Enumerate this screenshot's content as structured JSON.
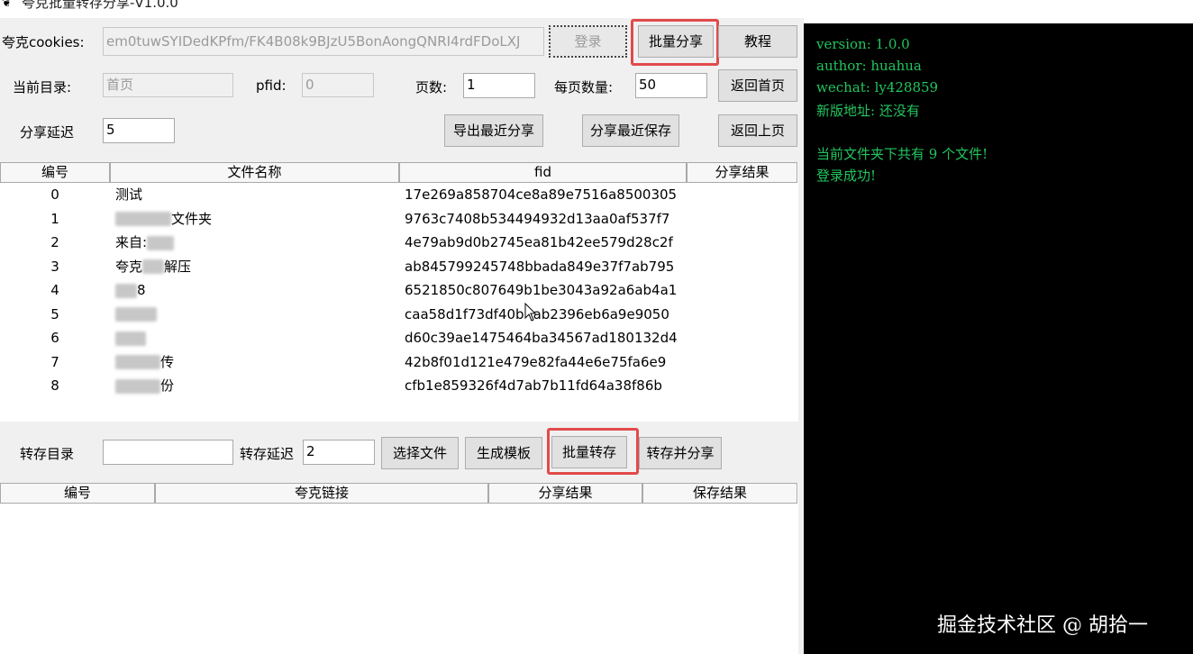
{
  "window": {
    "title": "夸克批量转存分享-V1.0.0",
    "minimize_glyph": "—",
    "app_icon": "app-icon"
  },
  "top": {
    "cookies_label": "夸克cookies:",
    "cookies_value": "em0tuwSYIDedKPfm/FK4B08k9BJzU5BonAongQNRI4rdFDoLXJ",
    "login_label": "登录",
    "batch_share_label": "批量分享",
    "tutorial_label": "教程",
    "current_dir_label": "当前目录:",
    "current_dir_value": "首页",
    "pfid_label": "pfid:",
    "pfid_value": "0",
    "page_label": "页数:",
    "page_value": "1",
    "per_page_label": "每页数量:",
    "per_page_value": "50",
    "back_home_label": "返回首页",
    "share_delay_label": "分享延迟",
    "share_delay_value": "5",
    "export_recent_share_label": "导出最近分享",
    "share_recent_save_label": "分享最近保存",
    "back_up_label": "返回上页"
  },
  "file_table": {
    "headers": [
      "编号",
      "文件名称",
      "fid",
      "分享结果"
    ],
    "rows": [
      {
        "id": "0",
        "pre": "",
        "name": "测试",
        "blur": 0,
        "fid": "17e269a858704ce8a89e7516a8500305",
        "result": ""
      },
      {
        "id": "1",
        "pre": "",
        "name": "文件夹",
        "blur": 62,
        "fid": "9763c7408b534494932d13aa0af537f7",
        "result": ""
      },
      {
        "id": "2",
        "pre": "来自:",
        "name": "",
        "blur": 30,
        "fid": "4e79ab9d0b2745ea81b42ee579d28c2f",
        "result": ""
      },
      {
        "id": "3",
        "pre": "夸克",
        "name": "解压",
        "blur": 24,
        "fid": "ab845799245748bbada849e37f7ab795",
        "result": ""
      },
      {
        "id": "4",
        "pre": "",
        "name": "8",
        "blur": 24,
        "fid": "6521850c807649b1be3043a92a6ab4a1",
        "result": ""
      },
      {
        "id": "5",
        "pre": "",
        "name": "",
        "blur": 46,
        "fid": "caa58d1f73df40b",
        "fid2": "ab2396eb6a9e9050",
        "result": ""
      },
      {
        "id": "6",
        "pre": "",
        "name": "",
        "blur": 34,
        "fid": "d60c39ae1475464ba34567ad180132d4",
        "result": ""
      },
      {
        "id": "7",
        "pre": "",
        "name": "传",
        "blur": 50,
        "fid": "42b8f01d121e479e82fa44e6e75fa6e9",
        "result": ""
      },
      {
        "id": "8",
        "pre": "",
        "name": "份",
        "blur": 50,
        "fid": "cfb1e859326f4d7ab7b11fd64a38f86b",
        "result": ""
      }
    ]
  },
  "bottom": {
    "save_dir_label": "转存目录",
    "save_dir_value": "",
    "save_delay_label": "转存延迟",
    "save_delay_value": "2",
    "choose_file_label": "选择文件",
    "gen_template_label": "生成模板",
    "batch_save_label": "批量转存",
    "save_and_share_label": "转存并分享"
  },
  "link_table": {
    "headers": [
      "编号",
      "夸克链接",
      "分享结果",
      "保存结果"
    ]
  },
  "console": {
    "lines": [
      "version: 1.0.0",
      "author: huahua",
      "wechat: ly428859",
      "新版地址: 还没有",
      "",
      "当前文件夹下共有 9 个文件!",
      "登录成功!"
    ]
  },
  "watermark": "掘金技术社区 @ 胡拾一",
  "colors": {
    "console_bg": "#000000",
    "console_text": "#22c55e",
    "highlight": "#e24a4a"
  }
}
